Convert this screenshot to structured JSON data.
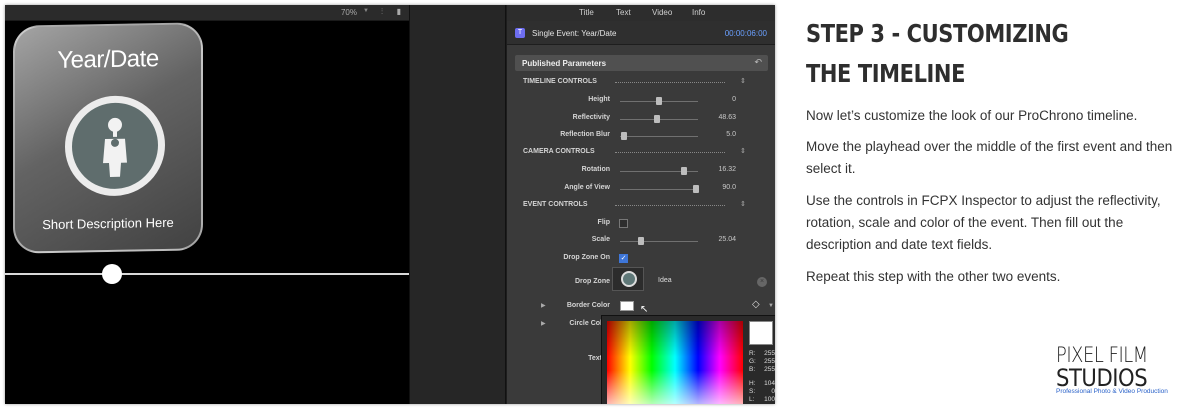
{
  "viewer": {
    "zoom": "70%",
    "card_title": "Year/Date",
    "card_description": "Short Description Here"
  },
  "inspector": {
    "tabs": [
      "Title",
      "Text",
      "Video",
      "Info"
    ],
    "event_title": "Single Event: Year/Date",
    "timecode": "00:00:06:00",
    "published_parameters": "Published Parameters",
    "timeline_controls": "TIMELINE CONTROLS",
    "camera_controls": "CAMERA CONTROLS",
    "event_controls": "EVENT CONTROLS",
    "height": {
      "label": "Height",
      "value": "0"
    },
    "reflectivity": {
      "label": "Reflectivity",
      "value": "48.63"
    },
    "reflection_blur": {
      "label": "Reflection Blur",
      "value": "5.0"
    },
    "rotation": {
      "label": "Rotation",
      "value": "16.32"
    },
    "angle_of_view": {
      "label": "Angle of View",
      "value": "90.0"
    },
    "flip": {
      "label": "Flip",
      "checked": false
    },
    "scale": {
      "label": "Scale",
      "value": "25.04"
    },
    "drop_zone_on": {
      "label": "Drop Zone On",
      "checked": true
    },
    "drop_zone": {
      "label": "Drop Zone",
      "name": "Idea"
    },
    "border_color": {
      "label": "Border Color"
    },
    "circle_color": {
      "label": "Circle Col"
    },
    "text_label": "Text",
    "picker": {
      "r": "255",
      "g": "255",
      "b": "255",
      "h": "104",
      "s": "0",
      "l": "100"
    }
  },
  "content": {
    "heading": "STEP 3 - CUSTOMIZING THE TIMELINE",
    "p1": "Now let’s customize the look of our ProChrono timeline.",
    "p2": "Move the playhead over the middle of the first event and then select it.",
    "p3": "Use the controls in FCPX Inspector to adjust the reflectivity, rotation, scale and color of the event. Then fill out the description and date text fields.",
    "p4": "Repeat this step with the other two events."
  },
  "brand": {
    "line1": "PIXEL FILM",
    "line2": "STUDIOS",
    "tagline": "Professional Photo & Video Production",
    "accent": "#2a62c9"
  }
}
